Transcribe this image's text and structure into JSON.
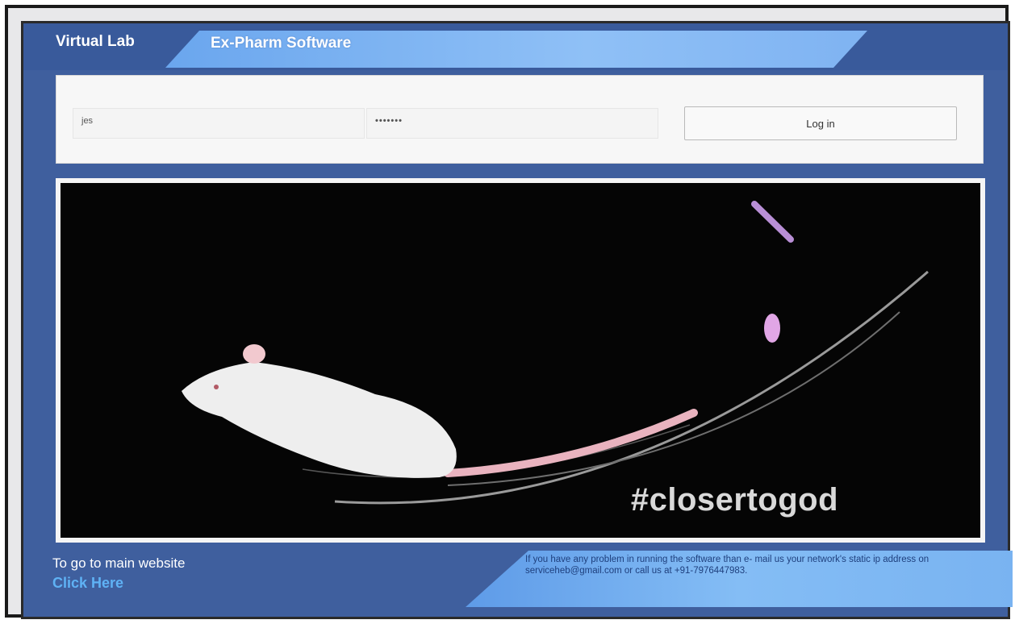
{
  "header": {
    "brand": "Virtual Lab",
    "title": "Ex-Pharm Software"
  },
  "login": {
    "username_value": "jes",
    "password_value": "•••••••",
    "login_label": "Log in"
  },
  "hero": {
    "hashtag": "#closertogod"
  },
  "footer": {
    "main_site_text": "To go to main website",
    "click_here": "Click Here",
    "support_note": "If you have any problem in running the software than e- mail us your network's static ip address on serviceheb@gmail.com or call us at +91-7976447983."
  },
  "colors": {
    "frame_blue": "#3f5f9e",
    "banner_light_blue": "#8fc0f6",
    "link_blue": "#5fb2f5"
  }
}
